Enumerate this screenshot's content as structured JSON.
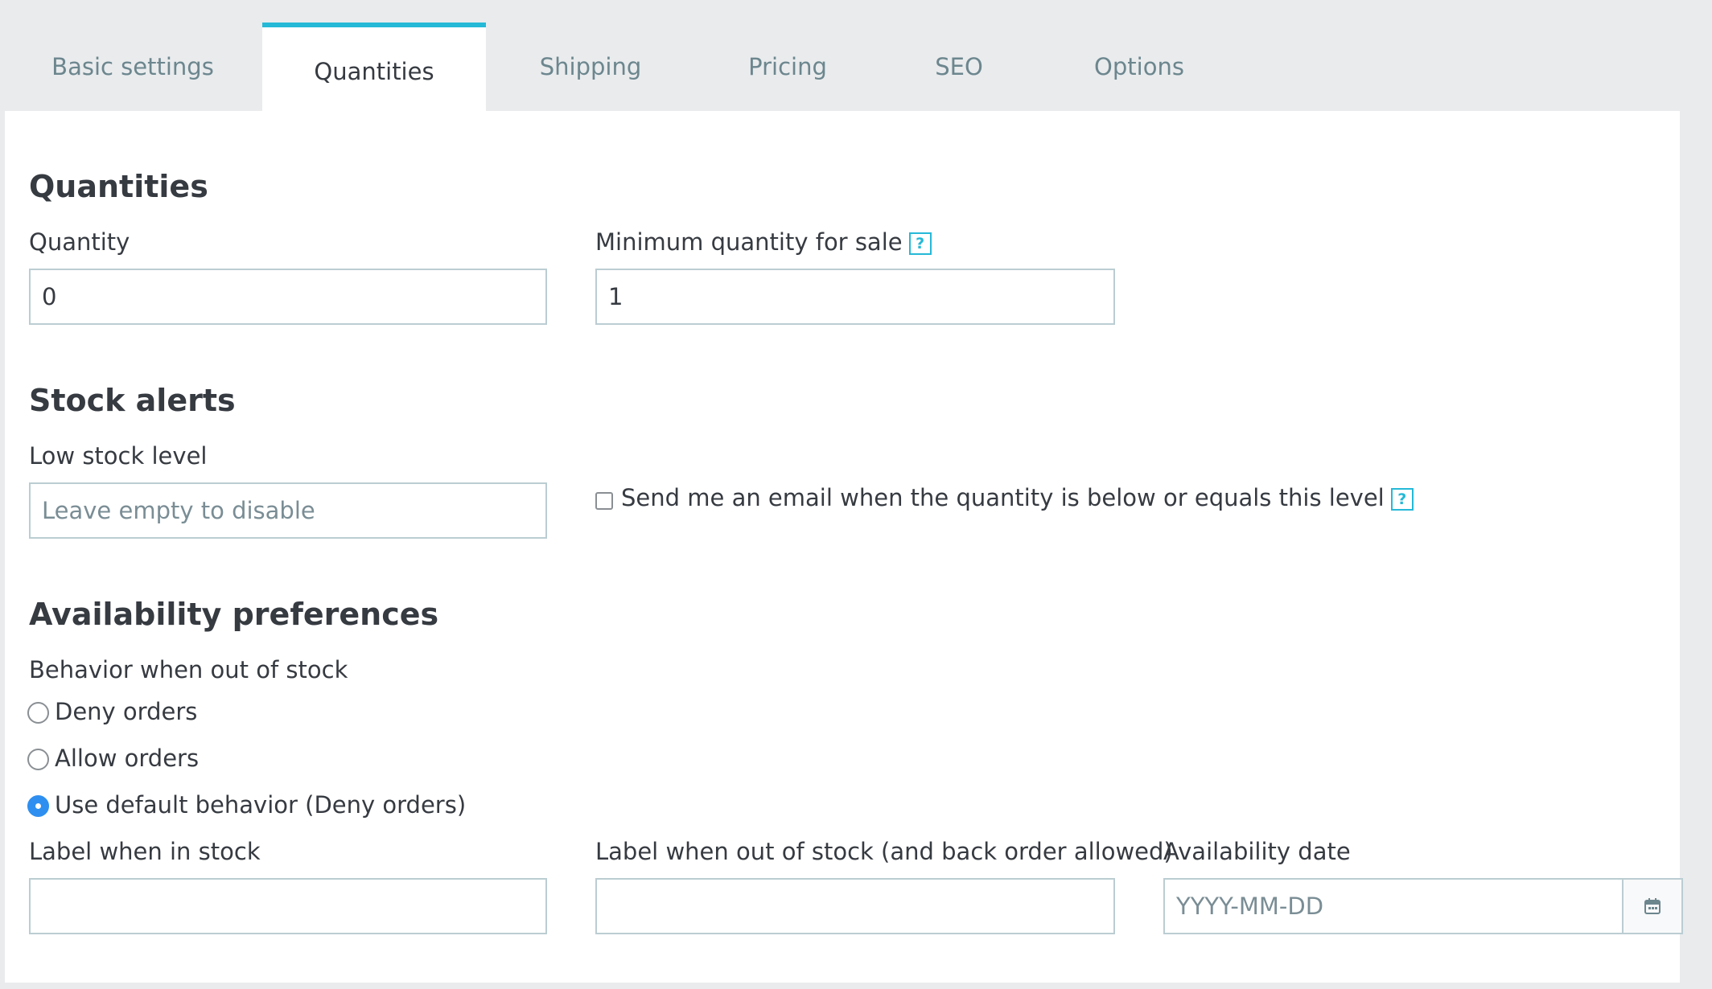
{
  "tabs": [
    {
      "label": "Basic settings"
    },
    {
      "label": "Quantities"
    },
    {
      "label": "Shipping"
    },
    {
      "label": "Pricing"
    },
    {
      "label": "SEO"
    },
    {
      "label": "Options"
    }
  ],
  "quantities": {
    "heading": "Quantities",
    "quantity_label": "Quantity",
    "quantity_value": "0",
    "min_qty_label": "Minimum quantity for sale",
    "min_qty_value": "1"
  },
  "help_glyph": "?",
  "stock_alerts": {
    "heading": "Stock alerts",
    "low_stock_label": "Low stock level",
    "low_stock_placeholder": "Leave empty to disable",
    "email_checkbox_label": "Send me an email when the quantity is below or equals this level",
    "email_checked": false
  },
  "availability": {
    "heading": "Availability preferences",
    "behavior_label": "Behavior when out of stock",
    "options": [
      {
        "label": "Deny orders",
        "selected": false
      },
      {
        "label": "Allow orders",
        "selected": false
      },
      {
        "label": "Use default behavior (Deny orders)",
        "selected": true
      }
    ],
    "in_stock_label": "Label when in stock",
    "in_stock_value": "",
    "out_of_stock_label": "Label when out of stock (and back order allowed)",
    "out_of_stock_value": "",
    "date_label": "Availability date",
    "date_placeholder": "YYYY-MM-DD",
    "calendar_icon": "calendar-icon"
  },
  "colors": {
    "accent": "#25b9d7",
    "radio_selected": "#2e8ff0",
    "input_border": "#bbcdd2",
    "tab_inactive_text": "#6c868e"
  }
}
